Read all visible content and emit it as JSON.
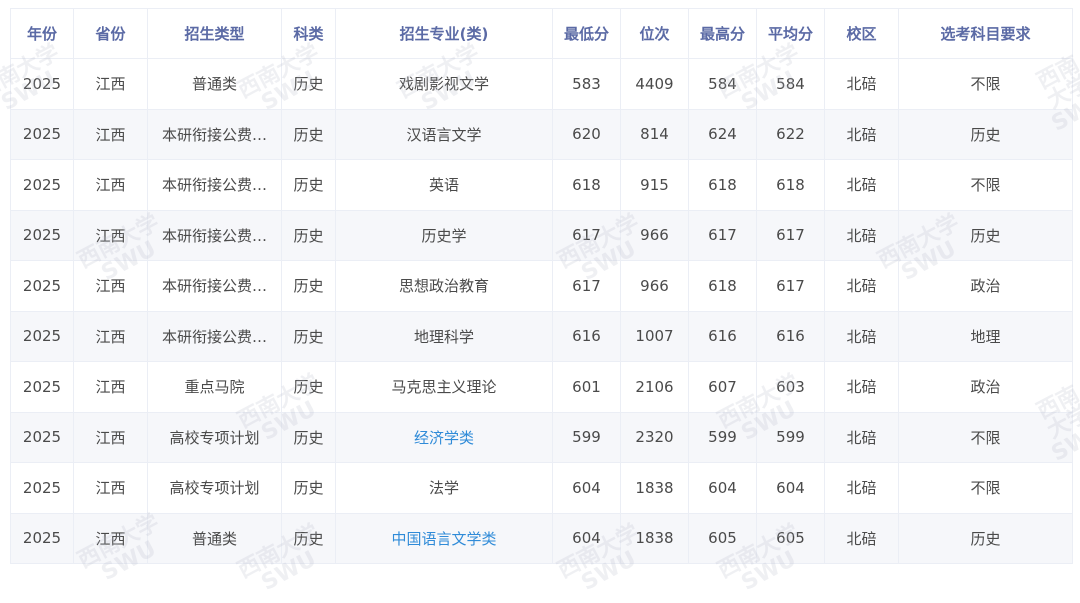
{
  "columns": [
    "年份",
    "省份",
    "招生类型",
    "科类",
    "招生专业(类)",
    "最低分",
    "位次",
    "最高分",
    "平均分",
    "校区",
    "选考科目要求"
  ],
  "rows": [
    {
      "year": "2025",
      "province": "江西",
      "type": "普通类",
      "subject": "历史",
      "major": "戏剧影视文学",
      "min": "583",
      "rank": "4409",
      "max": "584",
      "avg": "584",
      "campus": "北碚",
      "req": "不限",
      "link": false
    },
    {
      "year": "2025",
      "province": "江西",
      "type": "本研衔接公费…",
      "subject": "历史",
      "major": "汉语言文学",
      "min": "620",
      "rank": "814",
      "max": "624",
      "avg": "622",
      "campus": "北碚",
      "req": "历史",
      "link": false
    },
    {
      "year": "2025",
      "province": "江西",
      "type": "本研衔接公费…",
      "subject": "历史",
      "major": "英语",
      "min": "618",
      "rank": "915",
      "max": "618",
      "avg": "618",
      "campus": "北碚",
      "req": "不限",
      "link": false
    },
    {
      "year": "2025",
      "province": "江西",
      "type": "本研衔接公费…",
      "subject": "历史",
      "major": "历史学",
      "min": "617",
      "rank": "966",
      "max": "617",
      "avg": "617",
      "campus": "北碚",
      "req": "历史",
      "link": false
    },
    {
      "year": "2025",
      "province": "江西",
      "type": "本研衔接公费…",
      "subject": "历史",
      "major": "思想政治教育",
      "min": "617",
      "rank": "966",
      "max": "618",
      "avg": "617",
      "campus": "北碚",
      "req": "政治",
      "link": false
    },
    {
      "year": "2025",
      "province": "江西",
      "type": "本研衔接公费…",
      "subject": "历史",
      "major": "地理科学",
      "min": "616",
      "rank": "1007",
      "max": "616",
      "avg": "616",
      "campus": "北碚",
      "req": "地理",
      "link": false
    },
    {
      "year": "2025",
      "province": "江西",
      "type": "重点马院",
      "subject": "历史",
      "major": "马克思主义理论",
      "min": "601",
      "rank": "2106",
      "max": "607",
      "avg": "603",
      "campus": "北碚",
      "req": "政治",
      "link": false
    },
    {
      "year": "2025",
      "province": "江西",
      "type": "高校专项计划",
      "subject": "历史",
      "major": "经济学类",
      "min": "599",
      "rank": "2320",
      "max": "599",
      "avg": "599",
      "campus": "北碚",
      "req": "不限",
      "link": true
    },
    {
      "year": "2025",
      "province": "江西",
      "type": "高校专项计划",
      "subject": "历史",
      "major": "法学",
      "min": "604",
      "rank": "1838",
      "max": "604",
      "avg": "604",
      "campus": "北碚",
      "req": "不限",
      "link": false
    },
    {
      "year": "2025",
      "province": "江西",
      "type": "普通类",
      "subject": "历史",
      "major": "中国语言文学类",
      "min": "604",
      "rank": "1838",
      "max": "605",
      "avg": "605",
      "campus": "北碚",
      "req": "历史",
      "link": true
    }
  ],
  "watermark": {
    "line1": "西南大学",
    "line2": "SWU"
  },
  "colors": {
    "header_text": "#5b6aa5",
    "link": "#2f8bd8",
    "stripe": "#f6f7fa",
    "border": "#ebeef5"
  }
}
